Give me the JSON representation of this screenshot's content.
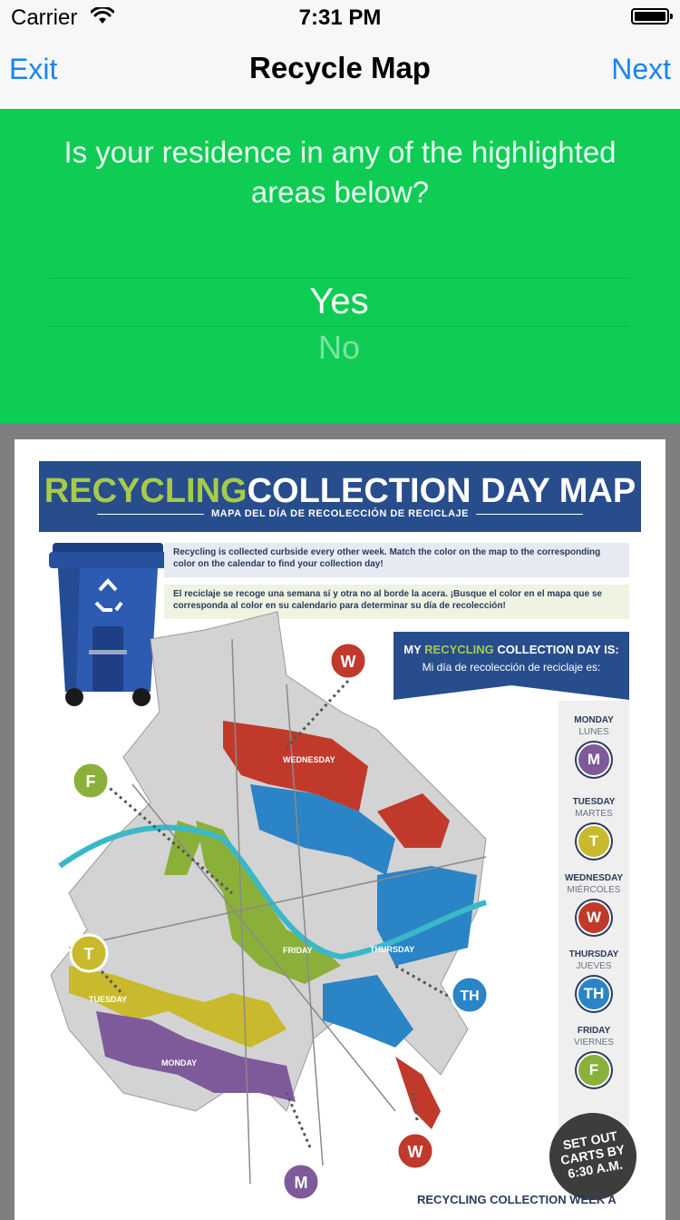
{
  "status_bar": {
    "carrier": "Carrier",
    "time": "7:31 PM",
    "icons": [
      "wifi-icon",
      "battery-icon"
    ]
  },
  "nav": {
    "left_label": "Exit",
    "title": "Recycle Map",
    "right_label": "Next",
    "accent_color": "#1a84f0"
  },
  "question": {
    "text": "Is your residence in any of the highlighted areas below?",
    "options": [
      "Yes",
      "No"
    ],
    "selected": "Yes",
    "background_color": "#0fcc55"
  },
  "map": {
    "title_green": "RECYCLING",
    "title_white": "COLLECTION DAY MAP",
    "subtitle": "MAPA DEL DÍA DE RECOLECCIÓN DE RECICLAJE",
    "info_en": "Recycling is collected curbside every other week. Match the color on the map to the corresponding color on the calendar to find your collection day!",
    "info_es": "El reciclaje se recoge una semana sí y otra no al borde la acera. ¡Busque el color en el mapa que se corresponda al color en su calendario para determinar su día de recolección!",
    "my_day_en_1": "MY",
    "my_day_en_green": "RECYCLING",
    "my_day_en_2": "COLLECTION DAY IS:",
    "my_day_es": "Mi día de recolección de reciclaje es:",
    "days": [
      {
        "en": "MONDAY",
        "es": "LUNES",
        "badge": "M",
        "color": "#7e5a9b"
      },
      {
        "en": "TUESDAY",
        "es": "MARTES",
        "badge": "T",
        "color": "#c9b92c"
      },
      {
        "en": "WEDNESDAY",
        "es": "MIÉRCOLES",
        "badge": "W",
        "color": "#c0392b"
      },
      {
        "en": "THURSDAY",
        "es": "JUEVES",
        "badge": "TH",
        "color": "#2a84c6"
      },
      {
        "en": "FRIDAY",
        "es": "VIERNES",
        "badge": "F",
        "color": "#8bb03a"
      }
    ],
    "zone_labels": {
      "wednesday": "WEDNESDAY",
      "thursday": "THURSDAY",
      "friday": "FRIDAY",
      "tuesday": "TUESDAY",
      "monday": "MONDAY"
    },
    "callouts": {
      "w_top": "W",
      "f": "F",
      "t": "T",
      "th": "TH",
      "w_bottom": "W",
      "m": "M"
    },
    "setout_lines": [
      "SET OUT",
      "CARTS BY",
      "6:30 A.M."
    ],
    "week_label": "RECYCLING COLLECTION WEEK A"
  }
}
